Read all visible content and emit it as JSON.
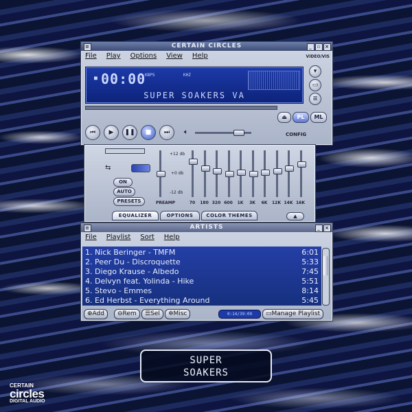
{
  "main_window": {
    "title": "CERTAIN CIRCLES",
    "menu": [
      "File",
      "Play",
      "Options",
      "View",
      "Help"
    ],
    "side_label": "VIDEO/VIS",
    "time": "00:00",
    "kbps_label": "KBPS",
    "khz_label": "KHZ",
    "track_title": "SUPER SOAKERS VA",
    "pl_button": "PL",
    "ml_button": "ML",
    "config_label": "CONFIG"
  },
  "equalizer": {
    "on_label": "ON",
    "auto_label": "AUTO",
    "presets_label": "PRESETS",
    "db_top": "+12 db",
    "db_mid": "+0 db",
    "db_bot": "-12 db",
    "preamp_label": "PREAMP",
    "bands": [
      "70",
      "180",
      "320",
      "600",
      "1K",
      "3K",
      "6K",
      "12K",
      "14K",
      "16K"
    ],
    "tabs": [
      "EQUALIZER",
      "OPTIONS",
      "COLOR THEMES"
    ]
  },
  "playlist": {
    "title": "ARTISTS",
    "menu": [
      "File",
      "Playlist",
      "Sort",
      "Help"
    ],
    "tracks": [
      {
        "name": "1. Nick Beringer - TMFM",
        "time": "6:01"
      },
      {
        "name": "2. Peer Du - Discroquette",
        "time": "5:33"
      },
      {
        "name": "3. Diego Krause - Albedo",
        "time": "7:45"
      },
      {
        "name": "4. Delvyn feat. Yolinda - Hike",
        "time": "5:51"
      },
      {
        "name": "5. Stevo - Emmes",
        "time": "8:14"
      },
      {
        "name": "6. Ed Herbst - Everything Around",
        "time": "5:45"
      }
    ],
    "buttons": {
      "add": "Add",
      "rem": "Rem",
      "sel": "Sel",
      "misc": "Misc",
      "manage": "Manage Playlist"
    },
    "total_time": "0:14/39:09"
  },
  "release": {
    "line1": "SUPER",
    "line2": "SOAKERS"
  },
  "brand": {
    "line1": "CERTAIN",
    "line2": "circles",
    "line3": "DIGITAL AUDIO"
  }
}
